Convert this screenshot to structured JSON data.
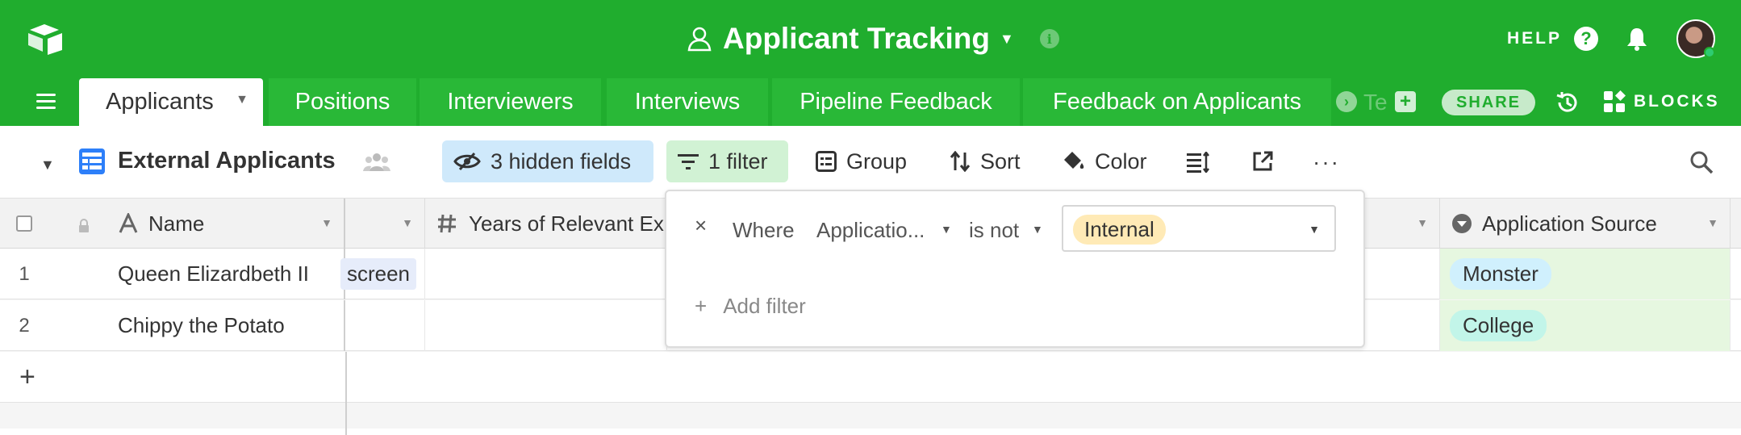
{
  "header": {
    "base_title": "Applicant Tracking",
    "help_label": "HELP",
    "help_icon": "question-circle-icon",
    "notifications_icon": "bell-icon",
    "brand_color": "#20ad2e"
  },
  "tabs": {
    "items": [
      {
        "label": "Applicants",
        "active": true
      },
      {
        "label": "Positions"
      },
      {
        "label": "Interviewers"
      },
      {
        "label": "Interviews"
      },
      {
        "label": "Pipeline Feedback"
      },
      {
        "label": "Feedback on Applicants"
      }
    ],
    "overflow_text": "Te",
    "share_label": "SHARE",
    "blocks_label": "BLOCKS"
  },
  "viewbar": {
    "view_name": "External Applicants",
    "hidden_fields_label": "3 hidden fields",
    "filter_label": "1 filter",
    "group_label": "Group",
    "sort_label": "Sort",
    "color_label": "Color",
    "more_label": "···"
  },
  "grid": {
    "columns": [
      {
        "label": "Name",
        "icon": "text-field-icon"
      },
      {
        "label": "Years of Relevant Ex",
        "icon": "number-hash-icon"
      },
      {
        "label": "Application Source",
        "icon": "single-select-icon"
      }
    ],
    "rows": [
      {
        "num": "1",
        "name": "Queen Elizardbeth II",
        "partial_stage": "screen",
        "source": "Monster"
      },
      {
        "num": "2",
        "name": "Chippy the Potato",
        "partial_stage": "",
        "source": "College"
      }
    ],
    "add_row_label": "+"
  },
  "filter_popover": {
    "remove_icon": "×",
    "where_label": "Where",
    "field": "Applicatio...",
    "operator": "is not",
    "value": "Internal",
    "add_filter_label": "Add filter",
    "add_filter_icon": "+"
  }
}
